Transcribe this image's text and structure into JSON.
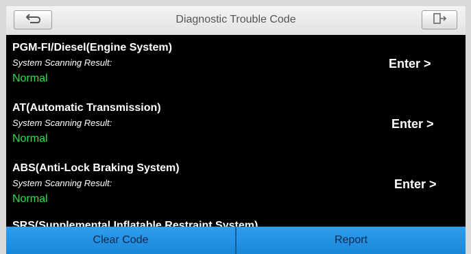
{
  "header": {
    "title": "Diagnostic Trouble Code",
    "back_icon": "back-arrow-icon",
    "exit_icon": "exit-door-icon"
  },
  "systems": [
    {
      "name": "PGM-FI/Diesel(Engine System)",
      "sub": "System Scanning Result:",
      "status": "Normal",
      "action": "Enter >"
    },
    {
      "name": "AT(Automatic Transmission)",
      "sub": "System Scanning Result:",
      "status": "Normal",
      "action": "Enter >"
    },
    {
      "name": "ABS(Anti-Lock Braking System)",
      "sub": "System Scanning Result:",
      "status": "Normal",
      "action": "Enter >"
    },
    {
      "name": "SRS(Supplemental Inflatable Restraint System)"
    }
  ],
  "footer": {
    "clear_label": "Clear Code",
    "report_label": "Report"
  },
  "colors": {
    "background": "#000000",
    "status_normal": "#27e34b",
    "footer_blue": "#1f8fe0"
  }
}
